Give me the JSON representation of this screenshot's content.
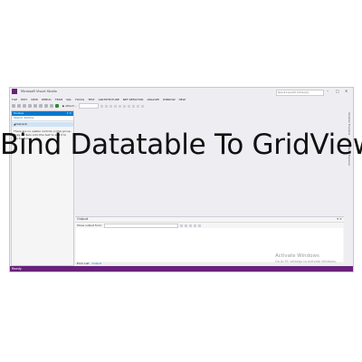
{
  "window": {
    "title": "Microsoft Visual Studio",
    "quick_launch_placeholder": "Quick Launch (Ctrl+Q)",
    "controls": {
      "minimize": "–",
      "maximize": "▢",
      "close": "✕"
    }
  },
  "menu": {
    "items": [
      "FILE",
      "EDIT",
      "VIEW",
      "DEBUG",
      "TEAM",
      "SQL",
      "TOOLS",
      "TEST",
      "ARCHITECTURE",
      "NET REFACTOR",
      "ANALYZE",
      "WINDOW",
      "HELP"
    ]
  },
  "toolbar": {
    "attach_label": "▶ Attach..."
  },
  "toolbox": {
    "title": "Toolbox",
    "pin": "▾ ✕",
    "search_placeholder": "Search Toolbox",
    "group_label": "◢ General",
    "empty_message": "There are no usable controls in this group. Drag an item onto this text to add it to the toolbox."
  },
  "side_tabs": [
    "Solution Explorer",
    "Team Explorer"
  ],
  "output": {
    "title": "Output",
    "controls": "▾ ✕",
    "show_from_label": "Show output from:"
  },
  "bottom_tabs": [
    "Error List",
    "Output"
  ],
  "status": {
    "text": "Ready"
  },
  "watermark": {
    "line1": "Activate Windows",
    "line2": "Go to PC settings to activate Windows."
  },
  "overlay": {
    "title": "Bind Datatable To GridView"
  },
  "colors": {
    "accent": "#007acc",
    "status_bar": "#68217a",
    "background": "#eeeef2"
  }
}
